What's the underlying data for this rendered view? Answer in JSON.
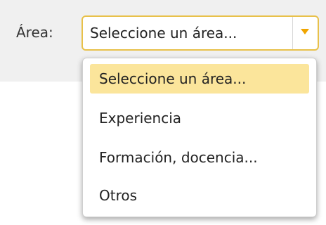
{
  "form": {
    "area_label": "Área:",
    "select": {
      "value": "Seleccione un área...",
      "options": [
        "Seleccione un área...",
        "Experiencia",
        "Formación, docencia...",
        "Otros"
      ],
      "selected_index": 0
    }
  },
  "icons": {
    "dropdown_arrow": "chevron-down-icon"
  },
  "colors": {
    "accent_border": "#e8c14a",
    "arrow": "#f0a500",
    "selected_option_bg": "#fbe59b",
    "form_background": "#f0f0f0"
  }
}
